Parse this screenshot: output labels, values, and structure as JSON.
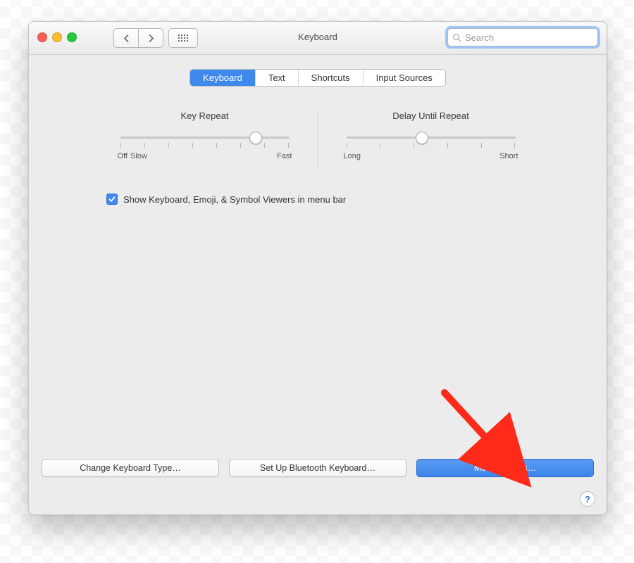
{
  "window": {
    "title": "Keyboard",
    "search_placeholder": "Search"
  },
  "tabs": [
    {
      "label": "Keyboard",
      "active": true
    },
    {
      "label": "Text",
      "active": false
    },
    {
      "label": "Shortcuts",
      "active": false
    },
    {
      "label": "Input Sources",
      "active": false
    }
  ],
  "sliders": {
    "key_repeat": {
      "title": "Key Repeat",
      "left_label": "Off",
      "left_label2": "Slow",
      "right_label": "Fast",
      "ticks": 8,
      "value_percent": 78
    },
    "delay_until_repeat": {
      "title": "Delay Until Repeat",
      "left_label": "Long",
      "right_label": "Short",
      "ticks": 6,
      "value_percent": 45
    }
  },
  "checkbox": {
    "checked": true,
    "label": "Show Keyboard, Emoji, & Symbol Viewers in menu bar"
  },
  "buttons": {
    "change_keyboard_type": "Change Keyboard Type…",
    "setup_bluetooth": "Set Up Bluetooth Keyboard…",
    "modifier_keys": "Modifier Keys…",
    "help": "?"
  },
  "colors": {
    "accent": "#3f88ec",
    "arrow": "#ff2a1a"
  }
}
